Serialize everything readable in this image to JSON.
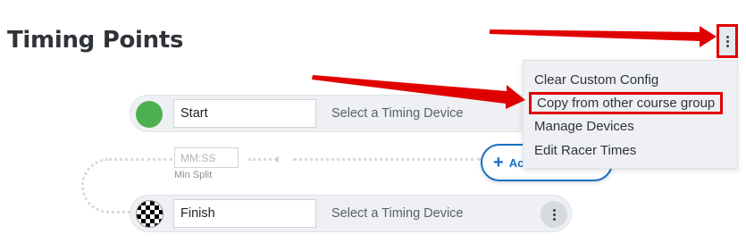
{
  "page": {
    "title": "Timing Points"
  },
  "timing_points": [
    {
      "name": "Start",
      "device_label": "Select a Timing Device",
      "marker": "start-dot"
    },
    {
      "name": "Finish",
      "device_label": "Select a Timing Device",
      "marker": "checkered-flag"
    }
  ],
  "split": {
    "placeholder": "MM:SS",
    "caption": "Min Split"
  },
  "add_button": {
    "label": "Ac"
  },
  "menu": {
    "items": [
      {
        "label": "Clear Custom Config"
      },
      {
        "label": "Copy from other course group"
      },
      {
        "label": "Manage Devices"
      },
      {
        "label": "Edit Racer Times"
      }
    ]
  },
  "colors": {
    "annotation": "#e00000",
    "start": "#4caf50",
    "accent": "#1a6fc4"
  },
  "icons": [
    "kebab-menu-icon",
    "left-arrow-icon",
    "plus-icon",
    "checkered-flag-icon"
  ]
}
